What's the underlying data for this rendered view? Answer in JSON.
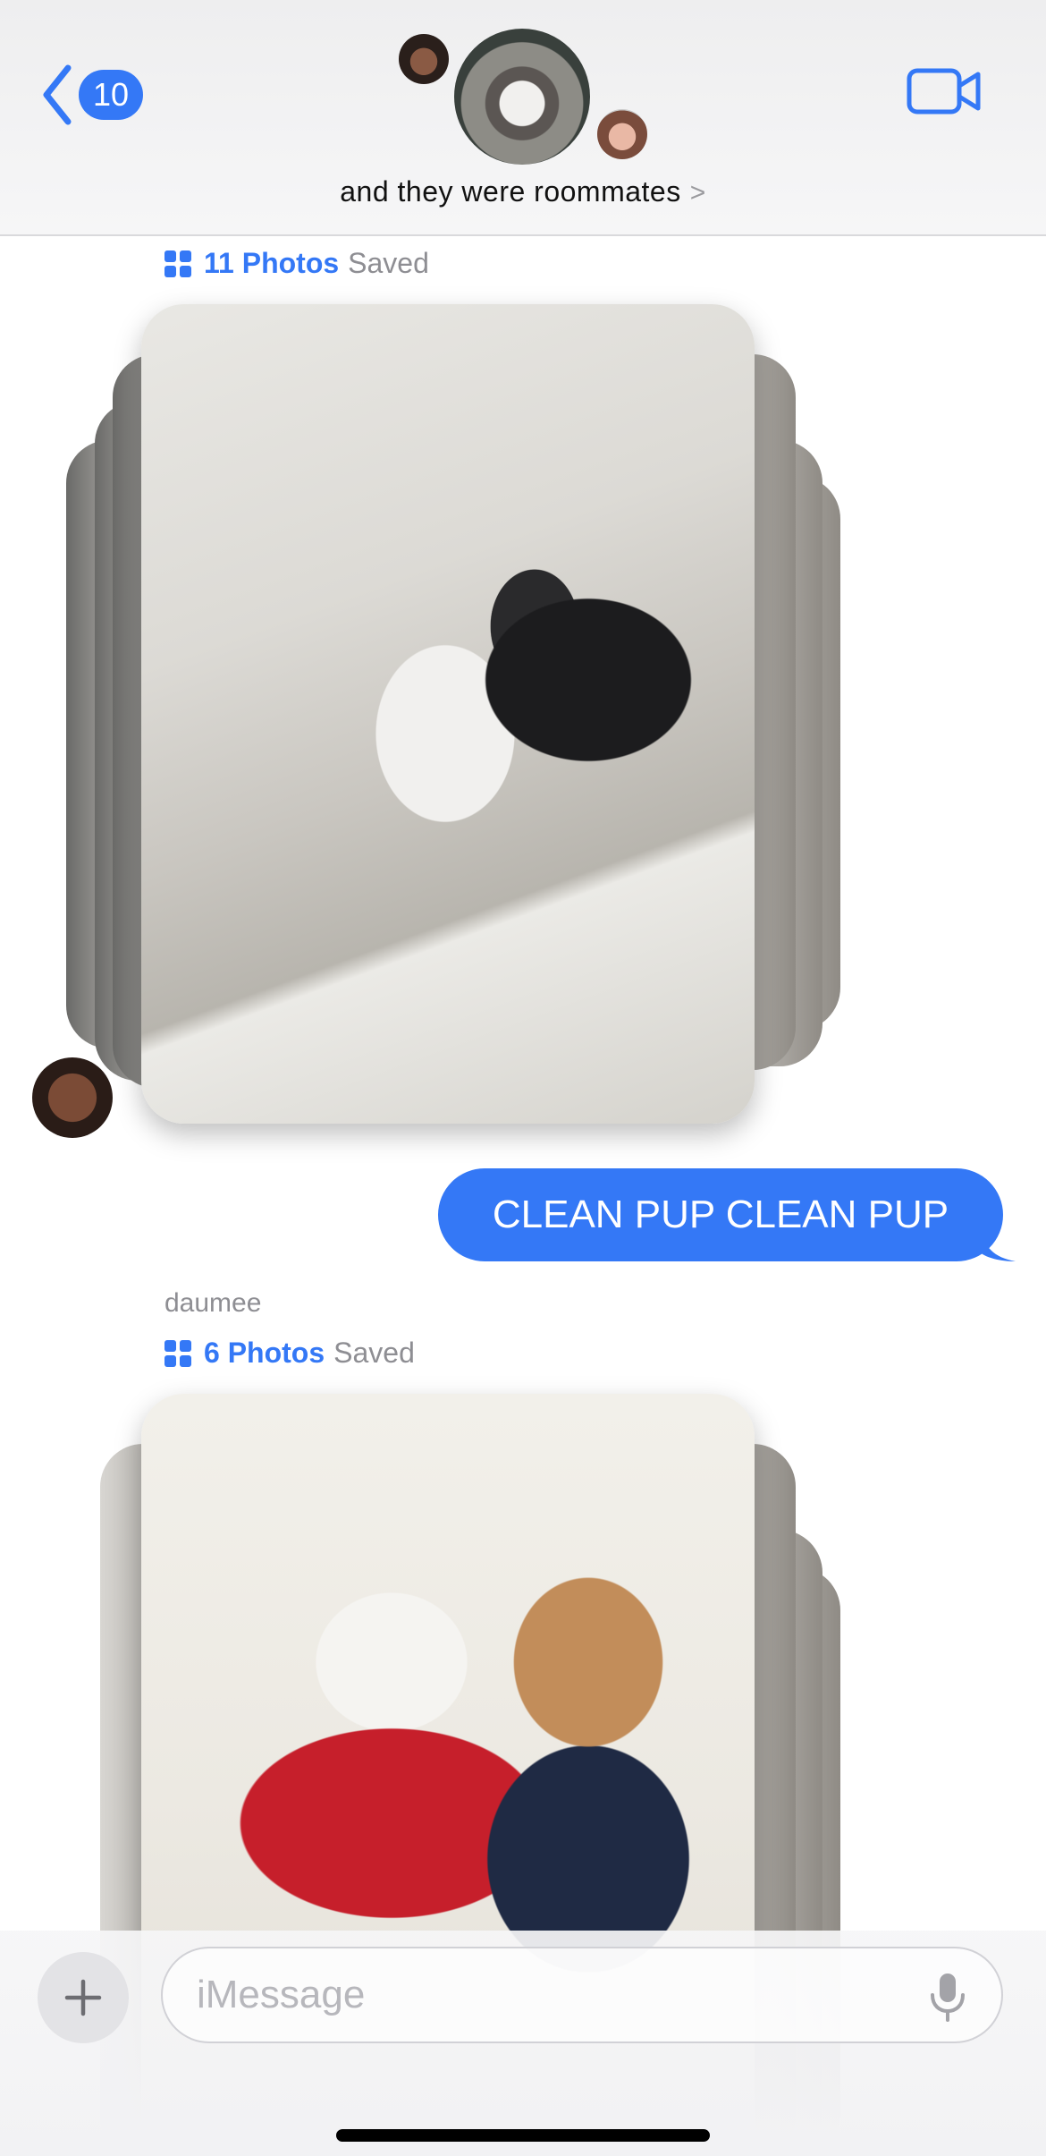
{
  "header": {
    "back_badge": "10",
    "group_name": "and they were roommates",
    "name_chevron": ">"
  },
  "messages": {
    "stack1": {
      "count_label": "11 Photos",
      "status": "Saved"
    },
    "outgoing_text": "CLEAN PUP CLEAN PUP",
    "sender_name": "daumee",
    "stack2": {
      "count_label": "6 Photos",
      "status": "Saved"
    }
  },
  "compose": {
    "placeholder": "iMessage"
  },
  "colors": {
    "accent": "#3478f6",
    "secondary_text": "#8e8e93"
  },
  "icons": [
    "back-chevron-icon",
    "video-camera-icon",
    "photo-grid-icon",
    "plus-icon",
    "microphone-icon"
  ]
}
